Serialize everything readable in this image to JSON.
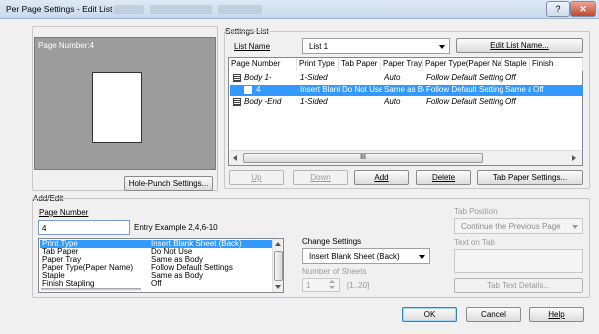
{
  "window": {
    "title": "Per Page Settings - Edit List",
    "help_btn": "?",
    "close_btn": "✕"
  },
  "preview": {
    "label": "Page Number:4"
  },
  "buttons": {
    "hole_punch": "Hole-Punch Settings...",
    "edit_list_name": "Edit List Name...",
    "up": "Up",
    "down": "Down",
    "add": "Add",
    "delete": "Delete",
    "tab_paper": "Tab Paper Settings...",
    "tab_text": "Tab Text Details...",
    "ok": "OK",
    "cancel": "Cancel",
    "help": "Help"
  },
  "settings_list": {
    "group_label": "Settings List",
    "list_name_label": "List Name",
    "list_name_value": "List 1",
    "columns": [
      "Page Number",
      "Print Type",
      "Tab Paper",
      "Paper Tray",
      "Paper Type(Paper Name)",
      "Staple",
      "Finish"
    ],
    "rows": [
      [
        "Body 1-",
        "1-Sided",
        "",
        "Auto",
        "Follow Default Settings",
        "Off",
        ""
      ],
      [
        "4",
        "Insert Blank",
        "Do Not Use",
        "Same as Bo",
        "Follow Default Settings",
        "Same as",
        "Off"
      ],
      [
        "Body -End",
        "1-Sided",
        "",
        "Auto",
        "Follow Default Settings",
        "Off",
        ""
      ]
    ],
    "hscroll_thumb": "III"
  },
  "add_edit": {
    "group_label": "Add/Edit",
    "page_number_label": "Page Number",
    "page_number_value": "4",
    "entry_example": "Entry Example 2,4,6-10",
    "props": [
      [
        "Print Type",
        "Insert Blank Sheet (Back)"
      ],
      [
        "Tab Paper",
        "Do Not Use"
      ],
      [
        "Paper Tray",
        "Same as Body"
      ],
      [
        "Paper Type(Paper Name)",
        "Follow Default Settings"
      ],
      [
        "Staple",
        "Same as Body"
      ],
      [
        "Finish Stapling",
        "Off"
      ]
    ],
    "change_settings_label": "Change Settings",
    "change_settings_value": "Insert Blank Sheet (Back)",
    "number_of_sheets_label": "Number of Sheets",
    "number_of_sheets_value": "1",
    "sheets_range": "[1..20]",
    "tab_position_label": "Tab Position",
    "tab_position_value": "Continue the Previous Page",
    "text_on_tab_label": "Text on Tab"
  }
}
